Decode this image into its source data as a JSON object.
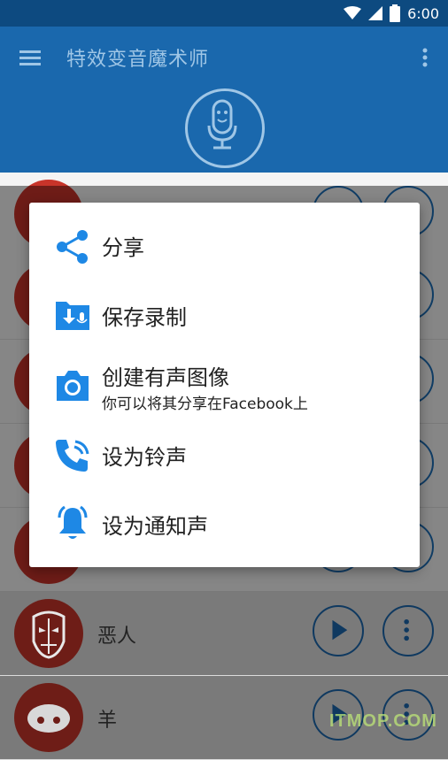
{
  "status_bar": {
    "time": "6:00"
  },
  "app_bar": {
    "title": "特效变音魔术师"
  },
  "list": {
    "rows": [
      {
        "label": ""
      },
      {
        "label": ""
      },
      {
        "label": ""
      },
      {
        "label": ""
      },
      {
        "label": ""
      },
      {
        "label": "恶人"
      },
      {
        "label": "羊"
      }
    ]
  },
  "dialog": {
    "items": [
      {
        "label": "分享",
        "icon": "share-icon"
      },
      {
        "label": "保存录制",
        "icon": "save-download-icon"
      },
      {
        "label": "创建有声图像",
        "sub": "你可以将其分享在Facebook上",
        "icon": "camera-icon"
      },
      {
        "label": "设为铃声",
        "icon": "phone-ringtone-icon"
      },
      {
        "label": "设为通知声",
        "icon": "bell-icon"
      }
    ]
  },
  "watermark": "ITMOP.COM",
  "colors": {
    "app_bar": "#1a68ad",
    "accent": "#1e88e5",
    "avatar_red": "#c8342a"
  }
}
